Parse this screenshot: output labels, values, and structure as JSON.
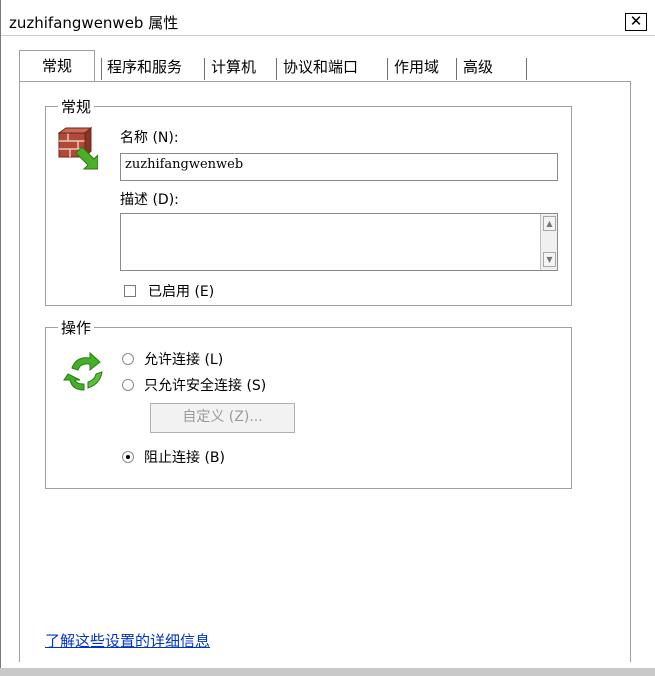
{
  "window": {
    "title": "zuzhifangwenweb 属性",
    "close_symbol": "✕"
  },
  "tabs": [
    {
      "label": "常规"
    },
    {
      "label": "程序和服务"
    },
    {
      "label": "计算机"
    },
    {
      "label": "协议和端口"
    },
    {
      "label": "作用域"
    },
    {
      "label": "高级"
    }
  ],
  "general": {
    "group_label": "常规",
    "icon": "firewall-brick-icon",
    "name_label": "名称 (N):",
    "name_value": "zuzhifangwenweb",
    "description_label": "描述 (D):",
    "description_value": "",
    "enabled_label": "已启用 (E)",
    "enabled": false
  },
  "action": {
    "group_label": "操作",
    "icon": "green-arrows-icon",
    "allow_label": "允许连接 (L)",
    "allow_secure_label": "只允许安全连接 (S)",
    "customize_label": "自定义 (Z)...",
    "block_label": "阻止连接 (B)",
    "selected": "block"
  },
  "footer": {
    "link_text": "了解这些设置的详细信息"
  },
  "colors": {
    "link": "#0033cc",
    "border": "#a0a0a0",
    "disabled_text": "#9a9a9a"
  }
}
